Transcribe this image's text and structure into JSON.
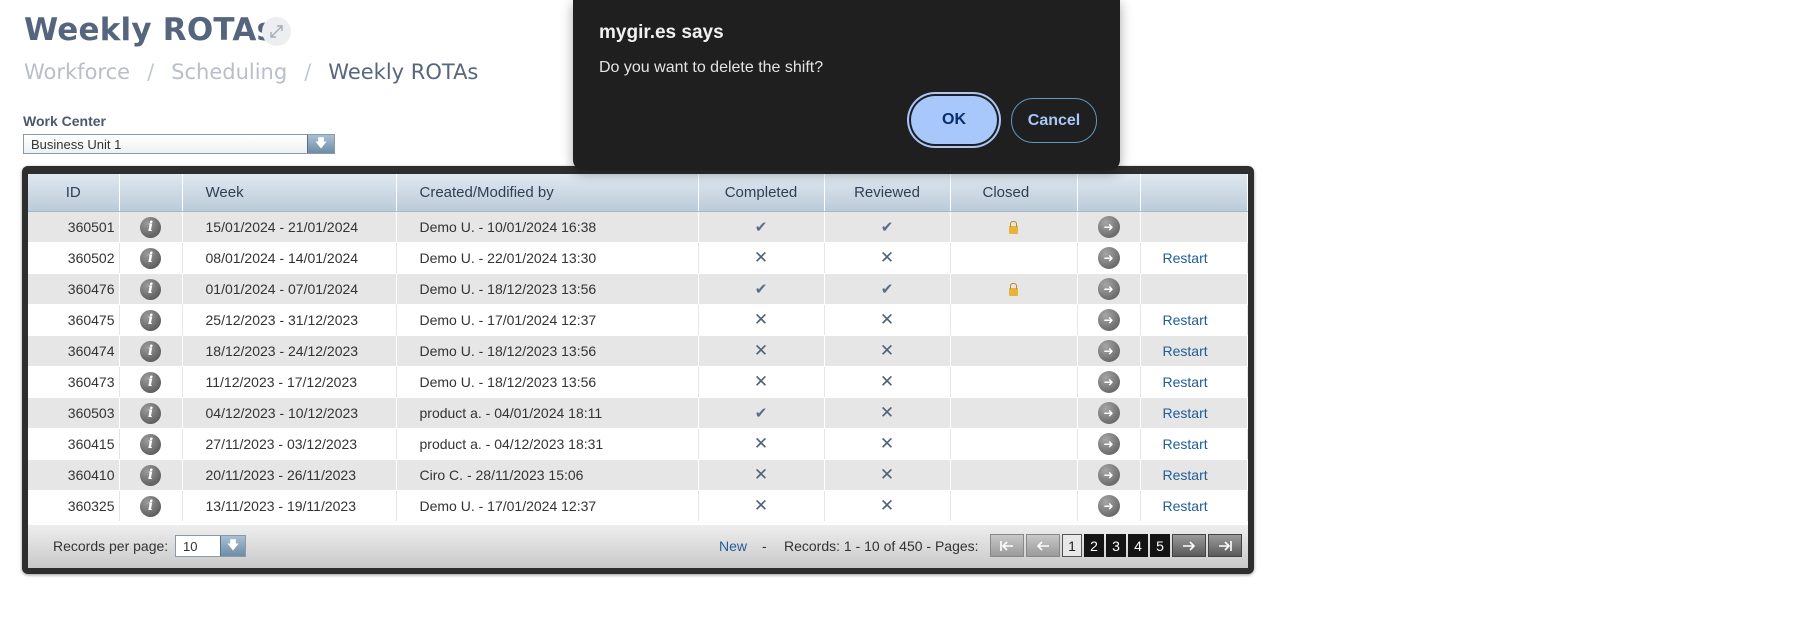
{
  "header": {
    "title": "Weekly ROTAs",
    "expand_icon": "↗↙"
  },
  "breadcrumb": {
    "items": [
      "Workforce",
      "Scheduling",
      "Weekly ROTAs"
    ],
    "separator": "/"
  },
  "work_center": {
    "label": "Work Center",
    "value": "Business Unit 1"
  },
  "grid": {
    "columns": [
      "ID",
      "",
      "Week",
      "Created/Modified by",
      "Completed",
      "Reviewed",
      "Closed",
      "",
      ""
    ],
    "rows": [
      {
        "id": "360501",
        "week": "15/01/2024 - 21/01/2024",
        "created": "Demo U. - 10/01/2024 16:38",
        "completed": "✔",
        "reviewed": "✔",
        "closed_locked": true,
        "action": ""
      },
      {
        "id": "360502",
        "week": "08/01/2024 - 14/01/2024",
        "created": "Demo U. - 22/01/2024 13:30",
        "completed": "✕",
        "reviewed": "✕",
        "closed_locked": false,
        "action": "Restart"
      },
      {
        "id": "360476",
        "week": "01/01/2024 - 07/01/2024",
        "created": "Demo U. - 18/12/2023 13:56",
        "completed": "✔",
        "reviewed": "✔",
        "closed_locked": true,
        "action": ""
      },
      {
        "id": "360475",
        "week": "25/12/2023 - 31/12/2023",
        "created": "Demo U. - 17/01/2024 12:37",
        "completed": "✕",
        "reviewed": "✕",
        "closed_locked": false,
        "action": "Restart"
      },
      {
        "id": "360474",
        "week": "18/12/2023 - 24/12/2023",
        "created": "Demo U. - 18/12/2023 13:56",
        "completed": "✕",
        "reviewed": "✕",
        "closed_locked": false,
        "action": "Restart"
      },
      {
        "id": "360473",
        "week": "11/12/2023 - 17/12/2023",
        "created": "Demo U. - 18/12/2023 13:56",
        "completed": "✕",
        "reviewed": "✕",
        "closed_locked": false,
        "action": "Restart"
      },
      {
        "id": "360503",
        "week": "04/12/2023 - 10/12/2023",
        "created": "product a. - 04/01/2024 18:11",
        "completed": "✔",
        "reviewed": "✕",
        "closed_locked": false,
        "action": "Restart"
      },
      {
        "id": "360415",
        "week": "27/11/2023 - 03/12/2023",
        "created": "product a. - 04/12/2023 18:31",
        "completed": "✕",
        "reviewed": "✕",
        "closed_locked": false,
        "action": "Restart"
      },
      {
        "id": "360410",
        "week": "20/11/2023 - 26/11/2023",
        "created": "Ciro C. - 28/11/2023 15:06",
        "completed": "✕",
        "reviewed": "✕",
        "closed_locked": false,
        "action": "Restart"
      },
      {
        "id": "360325",
        "week": "13/11/2023 - 19/11/2023",
        "created": "Demo U. - 17/01/2024 12:37",
        "completed": "✕",
        "reviewed": "✕",
        "closed_locked": false,
        "action": "Restart"
      }
    ],
    "info_icon_glyph": "i",
    "go_icon_glyph": "➜"
  },
  "footer": {
    "records_per_page_label": "Records per page:",
    "records_per_page_value": "10",
    "new_label": "New",
    "dash": "-",
    "records_text": "Records: 1 - 10 of 450 - Pages:",
    "pages": [
      "1",
      "2",
      "3",
      "4",
      "5"
    ],
    "active_page": "1"
  },
  "dialog": {
    "title": "mygir.es says",
    "message": "Do you want to delete the shift?",
    "ok_label": "OK",
    "cancel_label": "Cancel"
  },
  "colors": {
    "title": "#56657e",
    "link": "#1f5d98",
    "dialog_bg": "#1f1f1f",
    "ok_button": "#a8c7fa"
  }
}
